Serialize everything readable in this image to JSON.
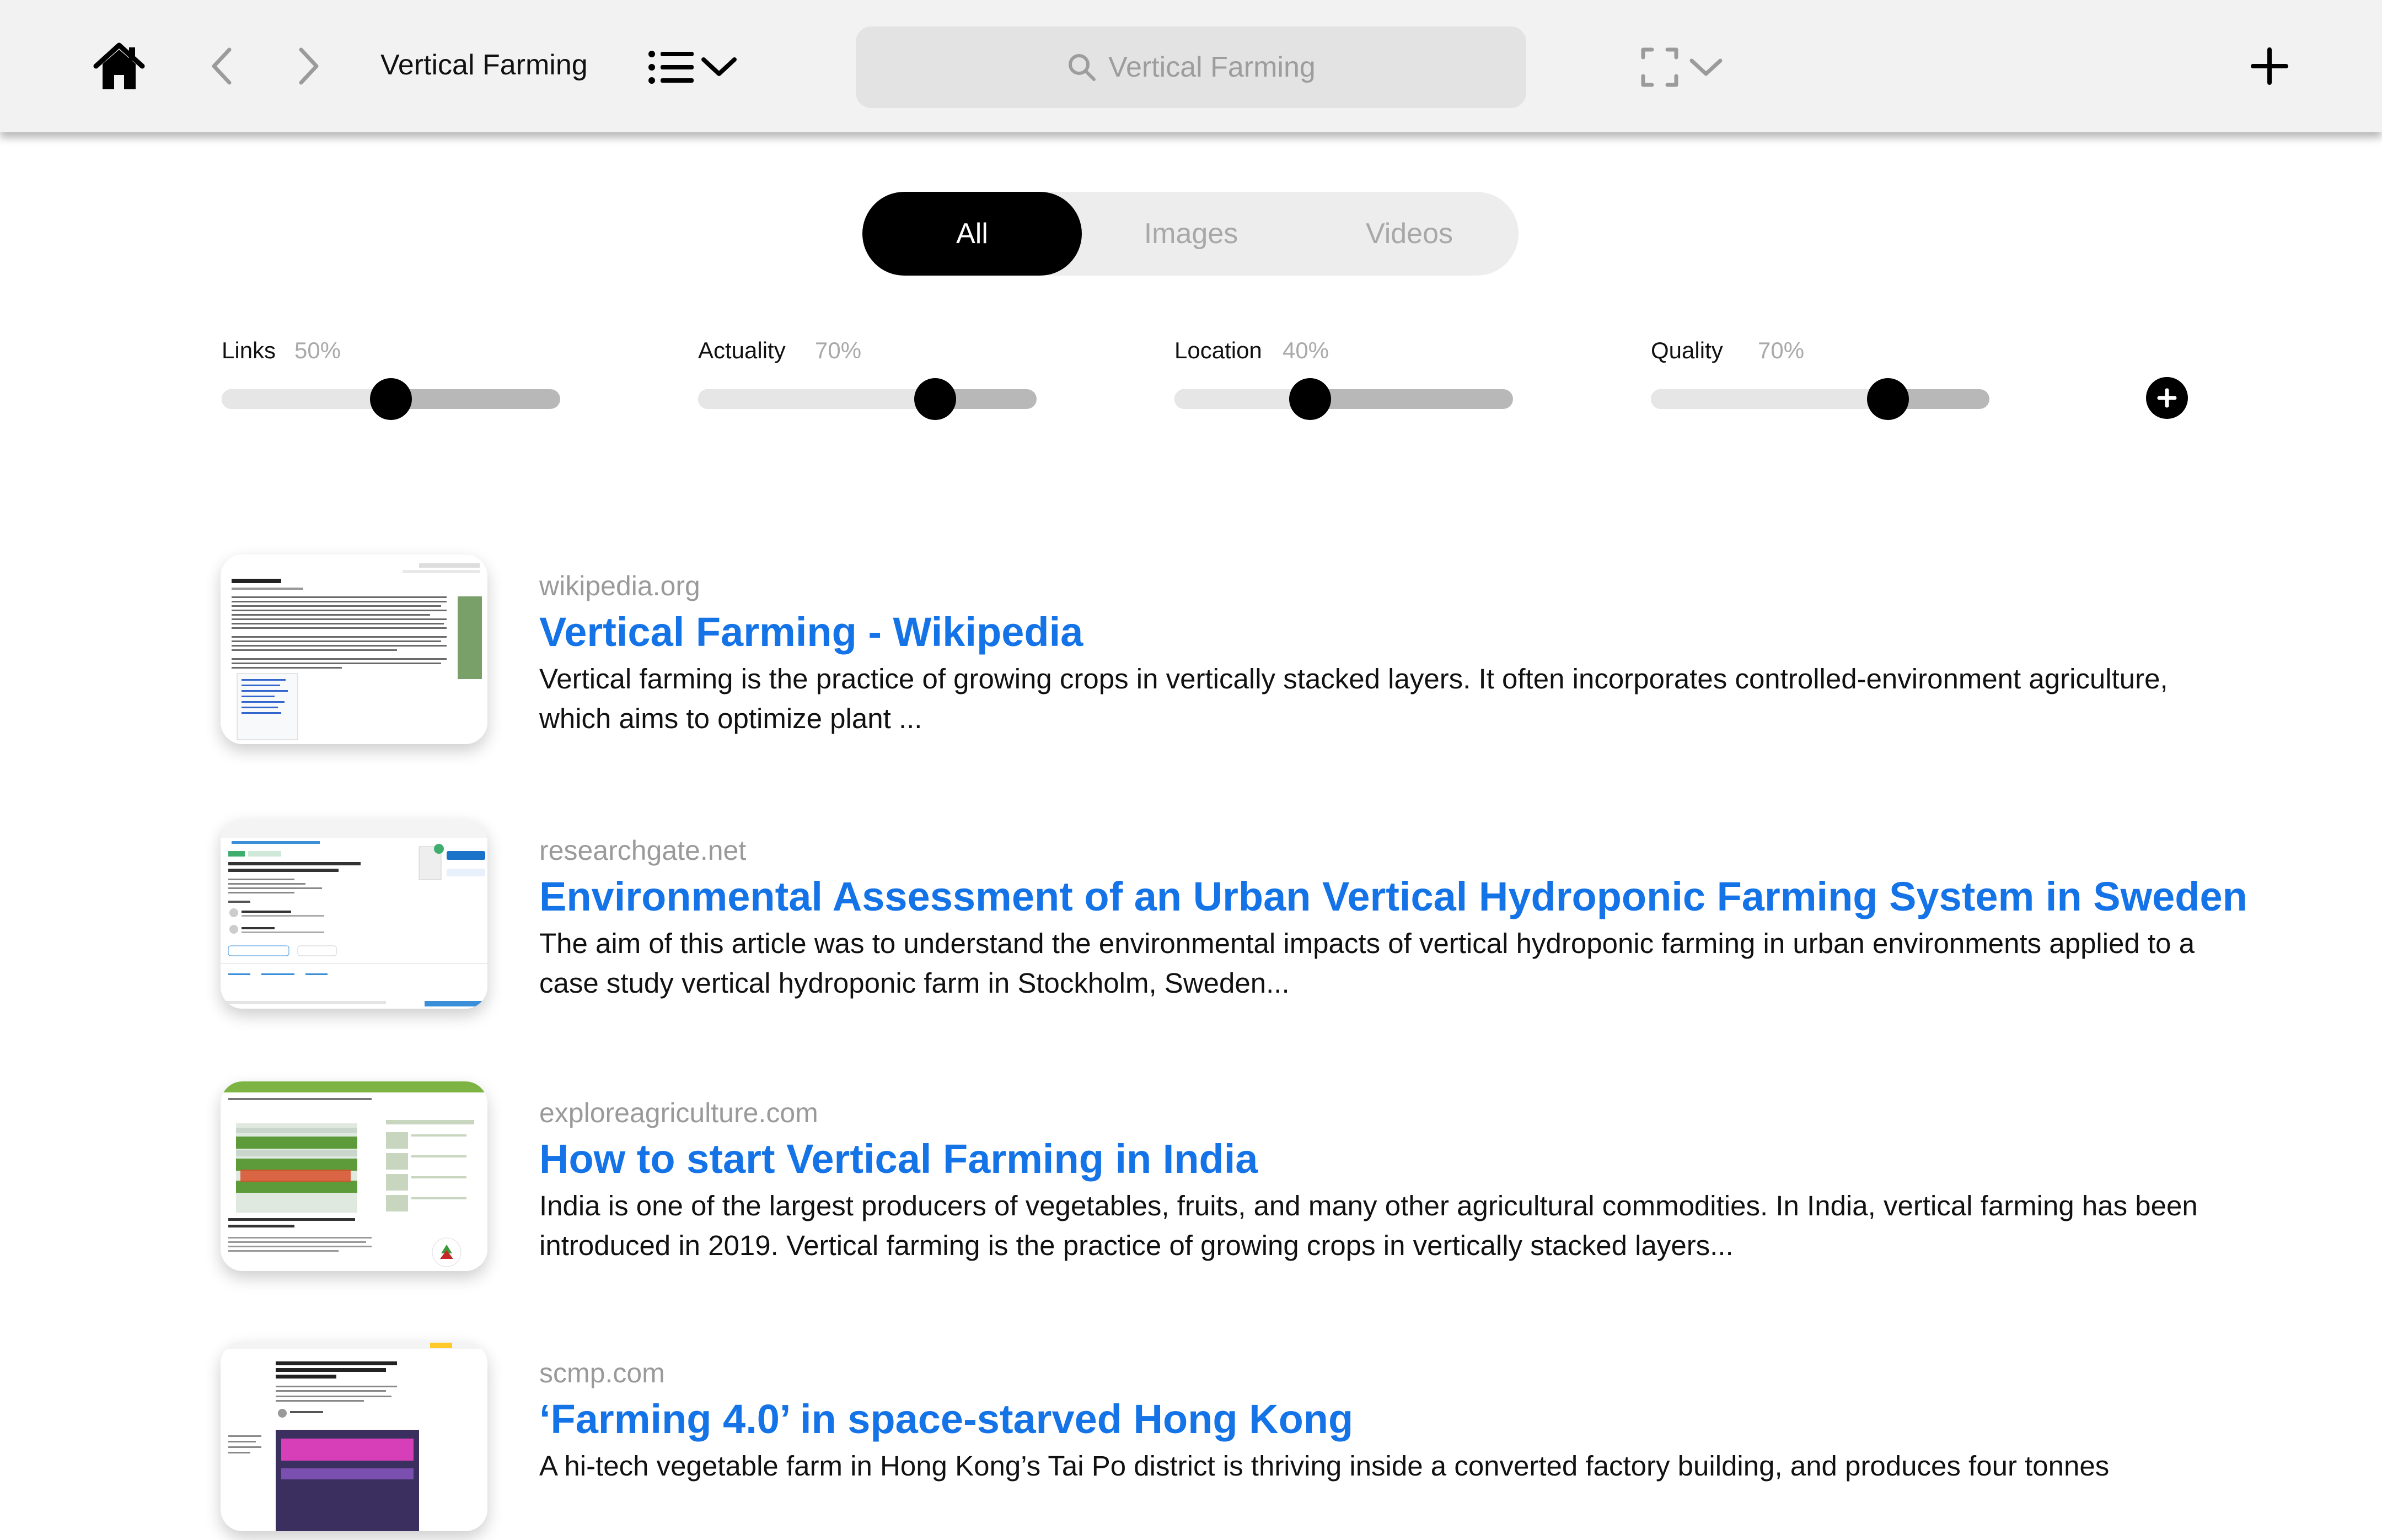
{
  "toolbar": {
    "title": "Vertical Farming",
    "search_placeholder": "Vertical Farming"
  },
  "tabs": [
    {
      "label": "All",
      "selected": true
    },
    {
      "label": "Images",
      "selected": false
    },
    {
      "label": "Videos",
      "selected": false
    }
  ],
  "sliders": [
    {
      "label": "Links",
      "value": "50%",
      "fraction": 0.5
    },
    {
      "label": "Actuality",
      "value": "70%",
      "fraction": 0.7
    },
    {
      "label": "Location",
      "value": "40%",
      "fraction": 0.4
    },
    {
      "label": "Quality",
      "value": "70%",
      "fraction": 0.7
    }
  ],
  "results": [
    {
      "domain": "wikipedia.org",
      "title": "Vertical Farming - Wikipedia",
      "snippet": "Vertical farming is the practice of growing crops in vertically stacked layers. It often incorporates controlled-environment agriculture, which aims to optimize plant ..."
    },
    {
      "domain": "researchgate.net",
      "title": "Environmental Assessment of an Urban Vertical Hydroponic Farming System in Sweden",
      "snippet": "The aim of this article was to understand the environmental impacts of vertical hydroponic farming in urban environments applied to a case study vertical hydroponic farm in Stockholm, Sweden..."
    },
    {
      "domain": "exploreagriculture.com",
      "title": "How to start Vertical Farming in India",
      "snippet": "India is one of the largest producers of vegetables, fruits, and many other agricultural commodities. In India, vertical farming has been introduced in 2019.  Vertical farming is the practice of growing crops in vertically stacked layers..."
    },
    {
      "domain": "scmp.com",
      "title": "‘Farming 4.0’ in space-starved Hong Kong",
      "snippet": "A hi-tech vegetable farm in Hong Kong’s Tai Po district is thriving inside a converted factory building, and produces four tonnes"
    }
  ],
  "colors": {
    "link": "#1473e6",
    "topbar": "#f2f2f2",
    "muted": "#9a9a9a"
  },
  "icons": [
    "home-icon",
    "back-icon",
    "forward-icon",
    "list-menu-icon",
    "chevron-down-icon",
    "search-icon",
    "expand-icon",
    "plus-icon",
    "plus-circle-icon"
  ]
}
